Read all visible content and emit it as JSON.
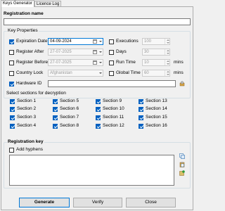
{
  "tabs": [
    "Keys Generator",
    "Licence Log"
  ],
  "registration_name": {
    "label": "Registration name",
    "value": ""
  },
  "key_properties": {
    "title": "Key Properties",
    "expiration_date": {
      "label": "Expiration Date",
      "checked": true,
      "value": "04-09-2024"
    },
    "register_after": {
      "label": "Register After",
      "checked": false,
      "value": "27-07-2025"
    },
    "register_before": {
      "label": "Register Before",
      "checked": false,
      "value": "27-07-2025"
    },
    "country_lock": {
      "label": "Country Lock",
      "checked": false,
      "value": "Afghanistan"
    },
    "hardware_id": {
      "label": "Hardware ID",
      "checked": true,
      "value": ""
    },
    "executions": {
      "label": "Executions",
      "checked": false,
      "value": "100"
    },
    "days": {
      "label": "Days",
      "checked": false,
      "value": "30"
    },
    "run_time": {
      "label": "Run Time",
      "checked": false,
      "value": "10",
      "unit": "mins"
    },
    "global_time": {
      "label": "Global Time",
      "checked": false,
      "value": "60",
      "unit": "mins"
    }
  },
  "sections": {
    "title": "Select sections for decryption",
    "items": [
      {
        "label": "Section 1",
        "checked": true
      },
      {
        "label": "Section 5",
        "checked": true
      },
      {
        "label": "Section 9",
        "checked": true
      },
      {
        "label": "Section 13",
        "checked": true
      },
      {
        "label": "Section 2",
        "checked": true
      },
      {
        "label": "Section 6",
        "checked": true
      },
      {
        "label": "Section 10",
        "checked": true
      },
      {
        "label": "Section 14",
        "checked": true
      },
      {
        "label": "Section 3",
        "checked": true
      },
      {
        "label": "Section 7",
        "checked": true
      },
      {
        "label": "Section 11",
        "checked": true
      },
      {
        "label": "Section 15",
        "checked": true
      },
      {
        "label": "Section 4",
        "checked": true
      },
      {
        "label": "Section 8",
        "checked": true
      },
      {
        "label": "Section 12",
        "checked": true
      },
      {
        "label": "Section 16",
        "checked": true
      }
    ]
  },
  "registration_key": {
    "title": "Registration key",
    "add_hyphens_label": "Add hyphens",
    "add_hyphens_checked": false,
    "value": ""
  },
  "buttons": {
    "generate": "Generate",
    "verify": "Verify",
    "close": "Close"
  },
  "colors": {
    "accent": "#0078d7",
    "checkbox": "#0060c0",
    "background": "#f0f0f0"
  },
  "icons": [
    "copy-icon",
    "paste-icon",
    "save-key-icon",
    "hardware-id-icon"
  ]
}
